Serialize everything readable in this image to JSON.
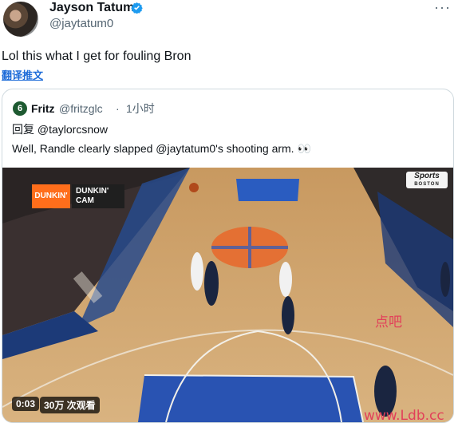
{
  "tweet": {
    "display_name": "Jayson Tatum",
    "handle": "@jaytatum0",
    "text": "Lol this what I get for fouling Bron",
    "translate_label": "翻译推文",
    "more": "···"
  },
  "quote": {
    "avatar_letter": "6",
    "display_name": "Fritz",
    "handle": "@fritzglc",
    "dot": "·",
    "time": "1小时",
    "reply_line": "回复 @taylorcsnow",
    "text": "Well, Randle clearly slapped @jaytatum0's shooting arm. 👀"
  },
  "video": {
    "broadcaster": "Sports",
    "broadcaster_sub": "BOSTON",
    "dunkin_logo": "DUNKIN'",
    "dunkin_cam_line1": "DUNKIN'",
    "dunkin_cam_line2": "CAM",
    "elapsed": "0:03",
    "views": "30万 次观看"
  },
  "watermarks": [
    "点吧",
    "www.Ldb.cc"
  ],
  "colors": {
    "link": "#1d6bd8",
    "verified": "#1d9bf0",
    "secondary": "#536471"
  }
}
